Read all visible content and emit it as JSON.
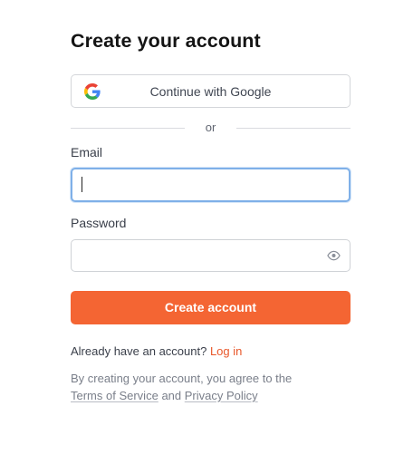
{
  "title": "Create your account",
  "google_button": {
    "label": "Continue with Google",
    "icon": "google-icon"
  },
  "divider": {
    "text": "or"
  },
  "email": {
    "label": "Email",
    "value": "",
    "placeholder": ""
  },
  "password": {
    "label": "Password",
    "value": "",
    "placeholder": "",
    "toggle_icon": "eye-icon"
  },
  "submit": {
    "label": "Create account"
  },
  "login": {
    "prompt": "Already have an account?",
    "link": "Log in"
  },
  "terms": {
    "line1": "By creating your account, you agree to the",
    "tos": "Terms of Service",
    "and": "and",
    "privacy": "Privacy Policy"
  },
  "colors": {
    "accent": "#f46533",
    "link": "#e8572a",
    "focus_border": "#7fb0e8",
    "google_blue": "#4285F4",
    "google_red": "#EA4335",
    "google_yellow": "#FBBC05",
    "google_green": "#34A853"
  }
}
